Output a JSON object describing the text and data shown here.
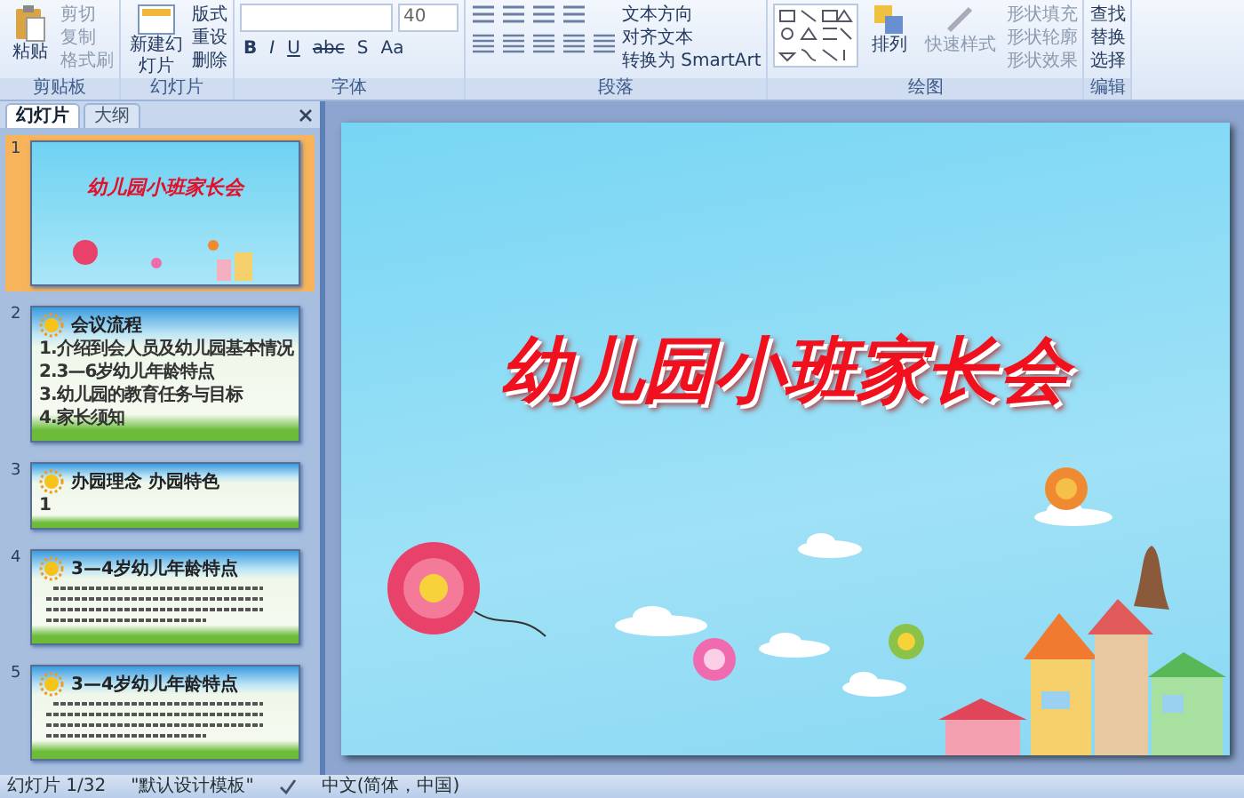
{
  "ribbon": {
    "clipboard": {
      "label": "剪贴板",
      "paste": "粘贴",
      "commands": [
        "剪切",
        "复制",
        "格式刷"
      ]
    },
    "slides": {
      "label": "幻灯片",
      "new_slide": "新建幻灯片",
      "commands": [
        "版式",
        "重设",
        "删除"
      ]
    },
    "font": {
      "label": "字体",
      "size": "40",
      "format_buttons": [
        "B",
        "I",
        "U",
        "abc",
        "S",
        "Aa"
      ]
    },
    "paragraph": {
      "label": "段落",
      "commands": [
        "文本方向",
        "对齐文本",
        "转换为 SmartArt"
      ]
    },
    "drawing": {
      "label": "绘图",
      "arrange": "排列",
      "quick_styles": "快速样式",
      "commands": [
        "形状填充",
        "形状轮廓",
        "形状效果"
      ]
    },
    "editing": {
      "label": "编辑",
      "commands": [
        "查找",
        "替换",
        "选择"
      ]
    }
  },
  "panel": {
    "tabs": [
      {
        "label": "幻灯片",
        "selected": true
      },
      {
        "label": "大纲",
        "selected": false
      }
    ],
    "slides": [
      {
        "number": "1",
        "selected": true,
        "kind": "cover",
        "title": "幼儿园小班家长会"
      },
      {
        "number": "2",
        "selected": false,
        "kind": "list",
        "title": "会议流程",
        "items": [
          "1.介绍到会人员及幼儿园基本情况",
          "2.3—6岁幼儿年龄特点",
          "3.幼儿园的教育任务与目标",
          "4.家长须知"
        ]
      },
      {
        "number": "3",
        "selected": false,
        "kind": "list",
        "title": "办园理念 办园特色",
        "items": [
          "1"
        ]
      },
      {
        "number": "4",
        "selected": false,
        "kind": "paragraph",
        "title": "3—4岁幼儿年龄特点"
      },
      {
        "number": "5",
        "selected": false,
        "kind": "paragraph",
        "title": "3—4岁幼儿年龄特点"
      }
    ]
  },
  "slide": {
    "title": "幼儿园小班家长会"
  },
  "status_bar": [
    "幻灯片 1/32",
    "\"默认设计模板\"",
    "中文(简体，中国)"
  ]
}
